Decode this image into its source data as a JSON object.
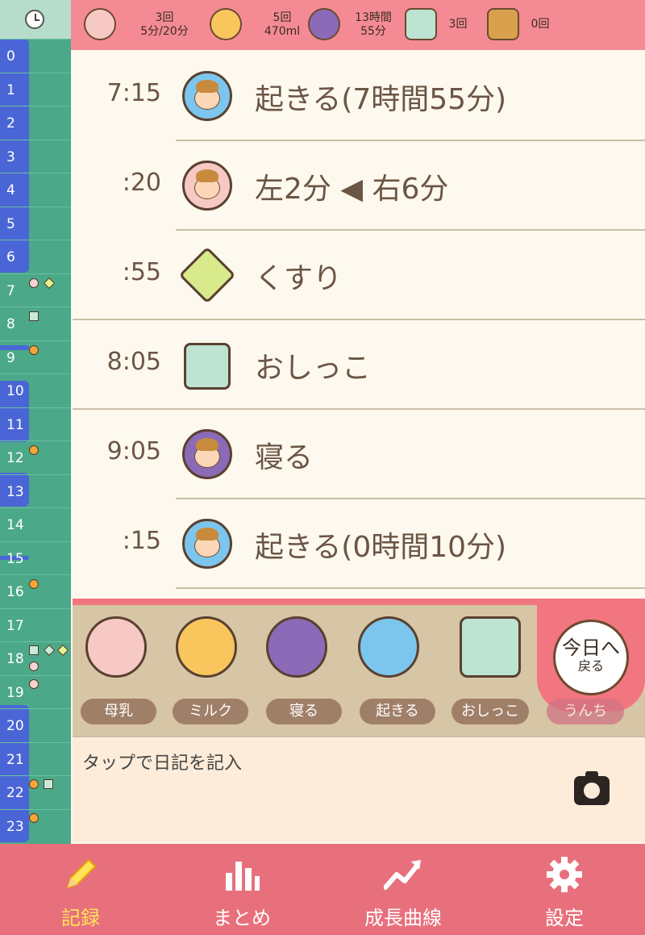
{
  "summary": {
    "breast": {
      "count": "3回",
      "detail": "5分/20分"
    },
    "milk": {
      "count": "5回",
      "detail": "470ml"
    },
    "sleep": {
      "count": "13時間",
      "detail": "55分"
    },
    "pee": {
      "count": "3回"
    },
    "poop": {
      "count": "0回"
    }
  },
  "timeline": {
    "hours": [
      "0",
      "1",
      "2",
      "3",
      "4",
      "5",
      "6",
      "7",
      "8",
      "9",
      "10",
      "11",
      "12",
      "13",
      "14",
      "15",
      "16",
      "17",
      "18",
      "19",
      "20",
      "21",
      "22",
      "23"
    ]
  },
  "log": [
    {
      "time": "7:15",
      "label": "起きる(7時間55分)",
      "icon": "wake-icon"
    },
    {
      "time": ":20",
      "label": "左2分 ◀ 右6分",
      "icon": "breastfeed-icon"
    },
    {
      "time": ":55",
      "label": "くすり",
      "icon": "medicine-icon"
    },
    {
      "time": "8:05",
      "label": "おしっこ",
      "icon": "pee-icon"
    },
    {
      "time": "9:05",
      "label": "寝る",
      "icon": "sleep-icon"
    },
    {
      "time": ":15",
      "label": "起きる(0時間10分)",
      "icon": "wake-icon"
    }
  ],
  "palette": {
    "buttons": [
      "母乳",
      "ミルク",
      "寝る",
      "起きる",
      "おしっこ",
      "うんち"
    ],
    "today_main": "今日へ",
    "today_sub": "戻る"
  },
  "diary": {
    "placeholder": "タップで日記を記入"
  },
  "nav": {
    "record": "記録",
    "summary": "まとめ",
    "growth": "成長曲線",
    "settings": "設定"
  },
  "colors": {
    "header": "#f48b94",
    "timeline": "#4ba989",
    "sleep_band": "#4a66d6",
    "nav": "#e8707c",
    "nav_active": "#ffe45a"
  }
}
